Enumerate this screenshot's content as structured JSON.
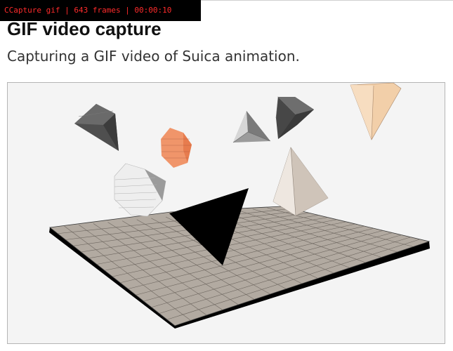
{
  "overlay": {
    "capture_status": "CCapture gif | 643 frames | 00:00:10"
  },
  "header": {
    "title": "GIF video capture",
    "subtitle": "Capturing a GIF video of Suica animation."
  },
  "scene": {
    "objects": [
      "dark-gray-pentagonal-gem",
      "orange-hexagonal-prism",
      "white-hexagonal-prism",
      "gray-tetrahedron",
      "dark-gray-cube",
      "peach-inverted-pyramid",
      "beige-pyramid",
      "black-pyramid",
      "tiled-floor"
    ],
    "colors": {
      "background": "#f4f4f4",
      "floor": "#b2aaa1",
      "floor_edge": "#000000",
      "dark_gray": "#555555",
      "orange": "#f0956a",
      "white": "#eeeeee",
      "peach": "#f2cfa9",
      "beige": "#ddd3c9",
      "black": "#000000"
    }
  }
}
